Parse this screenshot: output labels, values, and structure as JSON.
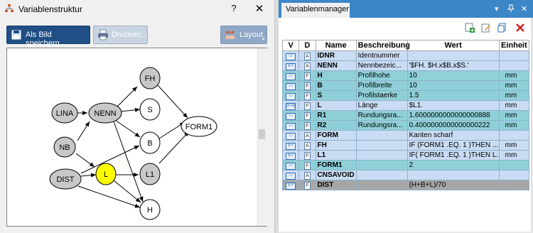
{
  "dialog": {
    "title": "Variablenstruktur",
    "help": "?",
    "close": "✕",
    "toolbar": {
      "save_label": "Als Bild speichern...",
      "print_label": "Drucken...",
      "layout_label": "Layout"
    }
  },
  "graph": {
    "nodes": [
      {
        "id": "FH",
        "label": "FH",
        "fill": "#c8c8c8"
      },
      {
        "id": "LINA",
        "label": "LINA",
        "fill": "#c8c8c8"
      },
      {
        "id": "NENN",
        "label": "NENN",
        "fill": "#c8c8c8"
      },
      {
        "id": "S",
        "label": "S",
        "fill": "#ffffff"
      },
      {
        "id": "FORM1",
        "label": "FORM1",
        "fill": "#ffffff"
      },
      {
        "id": "NB",
        "label": "NB",
        "fill": "#c8c8c8"
      },
      {
        "id": "B",
        "label": "B",
        "fill": "#ffffff"
      },
      {
        "id": "DIST",
        "label": "DIST",
        "fill": "#c8c8c8"
      },
      {
        "id": "L",
        "label": "L",
        "fill": "#ffff00"
      },
      {
        "id": "L1",
        "label": "L1",
        "fill": "#c8c8c8"
      },
      {
        "id": "H",
        "label": "H",
        "fill": "#ffffff"
      }
    ]
  },
  "manager": {
    "tab_label": "Variablenmanager",
    "window_controls": [
      "▾",
      "📌",
      "✕"
    ],
    "toolbar_icons": [
      "add-variable-icon",
      "edit-variable-icon",
      "copy-variable-icon",
      "delete-variable-icon"
    ],
    "columns": [
      "V",
      "D",
      "Name",
      "Beschreibung",
      "Wert",
      "Einheit"
    ],
    "rows": [
      {
        "v": "▭",
        "d": "A",
        "name": "IDNR",
        "desc": "Identnummer",
        "value": "",
        "unit": "",
        "style": "blue"
      },
      {
        "v": "E×",
        "d": "A",
        "name": "NENN",
        "desc": "Nennbezeic...",
        "value": "'$FH. $H.x$B.x$S.'",
        "unit": "",
        "style": "blue"
      },
      {
        "v": "▭",
        "d": "F",
        "name": "H",
        "desc": "Profilhohe",
        "value": "10",
        "unit": "mm",
        "style": "teal"
      },
      {
        "v": "▭",
        "d": "F",
        "name": "B",
        "desc": "Profilbreite",
        "value": "10",
        "unit": "mm",
        "style": "teal"
      },
      {
        "v": "▭",
        "d": "F",
        "name": "S",
        "desc": "Profilstaerke",
        "value": "1.5",
        "unit": "mm",
        "style": "teal"
      },
      {
        "v": "[0-9]",
        "d": "F",
        "name": "L",
        "desc": "Länge",
        "value": "$L1.",
        "unit": "mm",
        "style": "blue"
      },
      {
        "v": "▭",
        "d": "F",
        "name": "R1",
        "desc": "Rundungsra...",
        "value": "1.6000000000000000888",
        "unit": "mm",
        "style": "teal"
      },
      {
        "v": "▭",
        "d": "F",
        "name": "R2",
        "desc": "Rundungsra...",
        "value": "0.4000000000000000222",
        "unit": "mm",
        "style": "teal"
      },
      {
        "v": "▭",
        "d": "A",
        "name": "FORM",
        "desc": "",
        "value": "Kanten scharf",
        "unit": "",
        "style": "blue"
      },
      {
        "v": "E×",
        "d": "A",
        "name": "FH",
        "desc": "",
        "value": "IF (FORM1 .EQ. 1 )THEN ...",
        "unit": "mm",
        "style": "blue"
      },
      {
        "v": "E×",
        "d": "F",
        "name": "L1",
        "desc": "",
        "value": "IF( FORM1 .EQ. 1 )THEN L...",
        "unit": "mm",
        "style": "blue"
      },
      {
        "v": "▭",
        "d": "F",
        "name": "FORM1",
        "desc": "",
        "value": "2",
        "unit": "",
        "style": "teal"
      },
      {
        "v": "▭",
        "d": "A",
        "name": "CNSAVOID",
        "desc": "",
        "value": "",
        "unit": "",
        "style": "blue"
      },
      {
        "v": "E×",
        "d": "F",
        "name": "DIST",
        "desc": "",
        "value": "(H+B+L)/70",
        "unit": "",
        "style": "gray"
      }
    ]
  }
}
